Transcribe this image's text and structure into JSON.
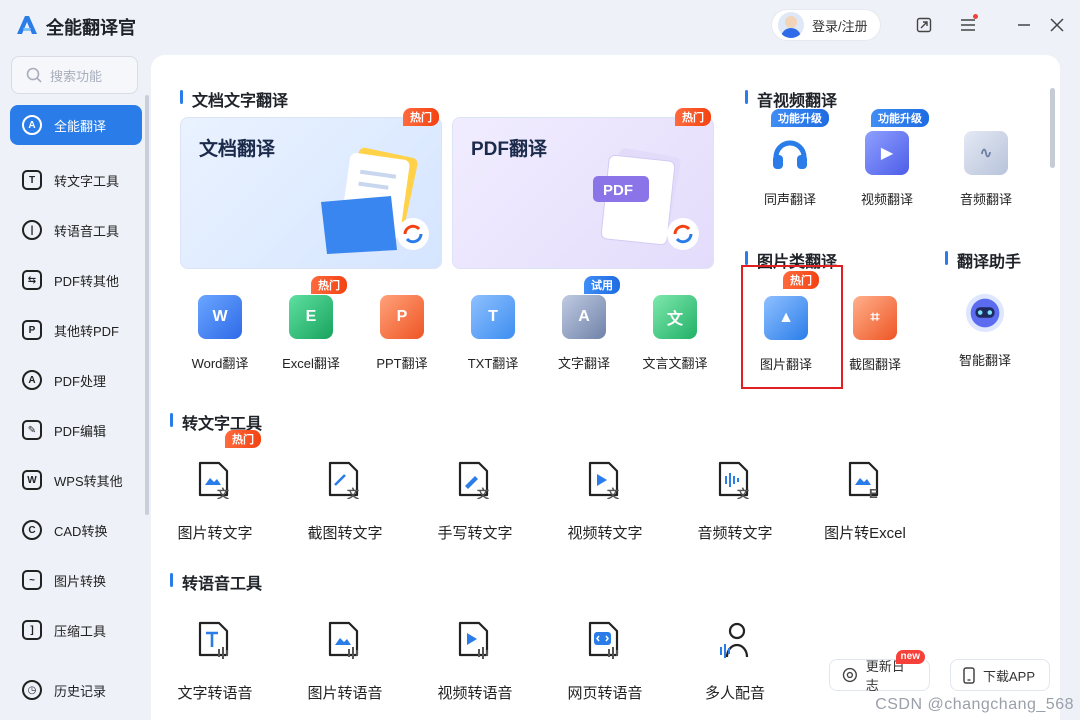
{
  "app": {
    "title": "全能翻译官",
    "accent": "#2a7de9",
    "hot_color": "#f34212"
  },
  "header": {
    "login_label": "登录/注册"
  },
  "sidebar": {
    "search_placeholder": "搜索功能",
    "items": [
      {
        "label": "全能翻译",
        "icon": "translate-icon",
        "active": true
      },
      {
        "label": "转文字工具",
        "icon": "text-icon"
      },
      {
        "label": "转语音工具",
        "icon": "voice-icon"
      },
      {
        "label": "PDF转其他",
        "icon": "pdf-convert-icon"
      },
      {
        "label": "其他转PDF",
        "icon": "to-pdf-icon"
      },
      {
        "label": "PDF处理",
        "icon": "pdf-process-icon"
      },
      {
        "label": "PDF编辑",
        "icon": "pdf-edit-icon"
      },
      {
        "label": "WPS转其他",
        "icon": "wps-icon"
      },
      {
        "label": "CAD转换",
        "icon": "cad-icon"
      },
      {
        "label": "图片转换",
        "icon": "image-icon"
      },
      {
        "label": "压缩工具",
        "icon": "compress-icon"
      }
    ],
    "history_label": "历史记录"
  },
  "doc_section": {
    "title": "文档文字翻译",
    "cards": [
      {
        "title": "文档翻译",
        "badge": "热门"
      },
      {
        "title": "PDF翻译",
        "badge": "热门"
      }
    ],
    "tools": [
      {
        "label": "Word翻译",
        "glyph": "W",
        "color": "#3b82f6",
        "badge": ""
      },
      {
        "label": "Excel翻译",
        "glyph": "E",
        "color": "#22b573",
        "badge": "热门"
      },
      {
        "label": "PPT翻译",
        "glyph": "P",
        "color": "#f26a3d",
        "badge": ""
      },
      {
        "label": "TXT翻译",
        "glyph": "T",
        "color": "#3d8ef0",
        "badge": ""
      },
      {
        "label": "文字翻译",
        "glyph": "A",
        "color": "#7b8db5",
        "badge": "试用"
      },
      {
        "label": "文言文翻译",
        "glyph": "文",
        "color": "#2cbf72",
        "badge": ""
      }
    ]
  },
  "av_section": {
    "title": "音视频翻译",
    "tools": [
      {
        "label": "同声翻译",
        "badge": "功能升级",
        "color": "#2a7de9"
      },
      {
        "label": "视频翻译",
        "badge": "功能升级",
        "color": "#4d5de8"
      },
      {
        "label": "音频翻译",
        "badge": "",
        "color": "#8a99b8"
      }
    ]
  },
  "image_section": {
    "title": "图片类翻译",
    "tools": [
      {
        "label": "图片翻译",
        "badge": "热门",
        "color": "#2a7de9"
      },
      {
        "label": "截图翻译",
        "badge": "",
        "color": "#f26a3d"
      }
    ]
  },
  "assistant_section": {
    "title": "翻译助手",
    "tools": [
      {
        "label": "智能翻译",
        "color": "#5b6cf0"
      }
    ]
  },
  "text_section": {
    "title": "转文字工具",
    "tools": [
      {
        "label": "图片转文字",
        "badge": "热门"
      },
      {
        "label": "截图转文字"
      },
      {
        "label": "手写转文字"
      },
      {
        "label": "视频转文字"
      },
      {
        "label": "音频转文字"
      },
      {
        "label": "图片转Excel"
      }
    ]
  },
  "voice_section": {
    "title": "转语音工具",
    "tools": [
      {
        "label": "文字转语音"
      },
      {
        "label": "图片转语音"
      },
      {
        "label": "视频转语音"
      },
      {
        "label": "网页转语音"
      },
      {
        "label": "多人配音"
      }
    ]
  },
  "footer": {
    "changelog_label": "更新日志",
    "changelog_badge": "new",
    "download_label": "下载APP",
    "watermark": "CSDN @changchang_568"
  }
}
